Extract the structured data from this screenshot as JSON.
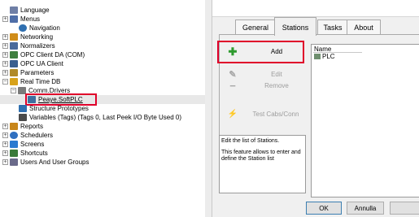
{
  "tree": {
    "items": [
      {
        "label": "Language",
        "icon": "language-icon",
        "color": "#6f7fa6"
      },
      {
        "label": "Menus",
        "icon": "menus-icon",
        "color": "#4f6ea8"
      },
      {
        "label": "Navigation",
        "icon": "navigation-icon",
        "color": "#2f6fb0"
      },
      {
        "label": "Networking",
        "icon": "networking-icon",
        "color": "#d08d1a"
      },
      {
        "label": "Normalizers",
        "icon": "normalizers-icon",
        "color": "#4a6a9a"
      },
      {
        "label": "OPC Client DA (COM)",
        "icon": "opc-da-icon",
        "color": "#3f7f3f"
      },
      {
        "label": "OPC UA Client",
        "icon": "opc-ua-icon",
        "color": "#3a5f8f"
      },
      {
        "label": "Parameters",
        "icon": "parameters-icon",
        "color": "#b08a2a"
      },
      {
        "label": "Real Time DB",
        "icon": "realtime-db-icon",
        "color": "#d8a21a"
      },
      {
        "label": "Comm.Drivers",
        "icon": "comm-drivers-icon",
        "color": "#7a7a7a"
      },
      {
        "label": "Peaye.SoftPLC",
        "icon": "driver-icon",
        "color": "#3f6f9f"
      },
      {
        "label": "Structure Prototypes",
        "icon": "structure-prototypes-icon",
        "color": "#2f6fb0"
      },
      {
        "label": "Variables (Tags) (Tags 0, Last Peek I/O Byte Used 0)",
        "icon": "variables-icon",
        "color": "#4a4a4a"
      },
      {
        "label": "Reports",
        "icon": "reports-icon",
        "color": "#c8861a"
      },
      {
        "label": "Schedulers",
        "icon": "schedulers-icon",
        "color": "#3070c0"
      },
      {
        "label": "Screens",
        "icon": "screens-icon",
        "color": "#2a7ad0"
      },
      {
        "label": "Shortcuts",
        "icon": "shortcuts-icon",
        "color": "#3a7a3a"
      },
      {
        "label": "Users And User Groups",
        "icon": "users-icon",
        "color": "#6a6a8a"
      }
    ]
  },
  "dialog": {
    "tabs": [
      "General",
      "Stations",
      "Tasks",
      "About"
    ],
    "active_tab": "Stations",
    "buttons": {
      "add": "Add",
      "edit": "Edit",
      "remove": "Remove",
      "test": "Test Cabs/Conn"
    },
    "list": {
      "header": "Name",
      "items": [
        "PLC"
      ]
    },
    "description": {
      "line1": "Edit the list of Stations.",
      "line2": "This feature allows to enter and define the Station list"
    },
    "footer": {
      "ok": "OK",
      "cancel": "Annulla"
    },
    "colors": {
      "highlight": "#e0002a",
      "add_icon": "#2e9a2e"
    }
  }
}
